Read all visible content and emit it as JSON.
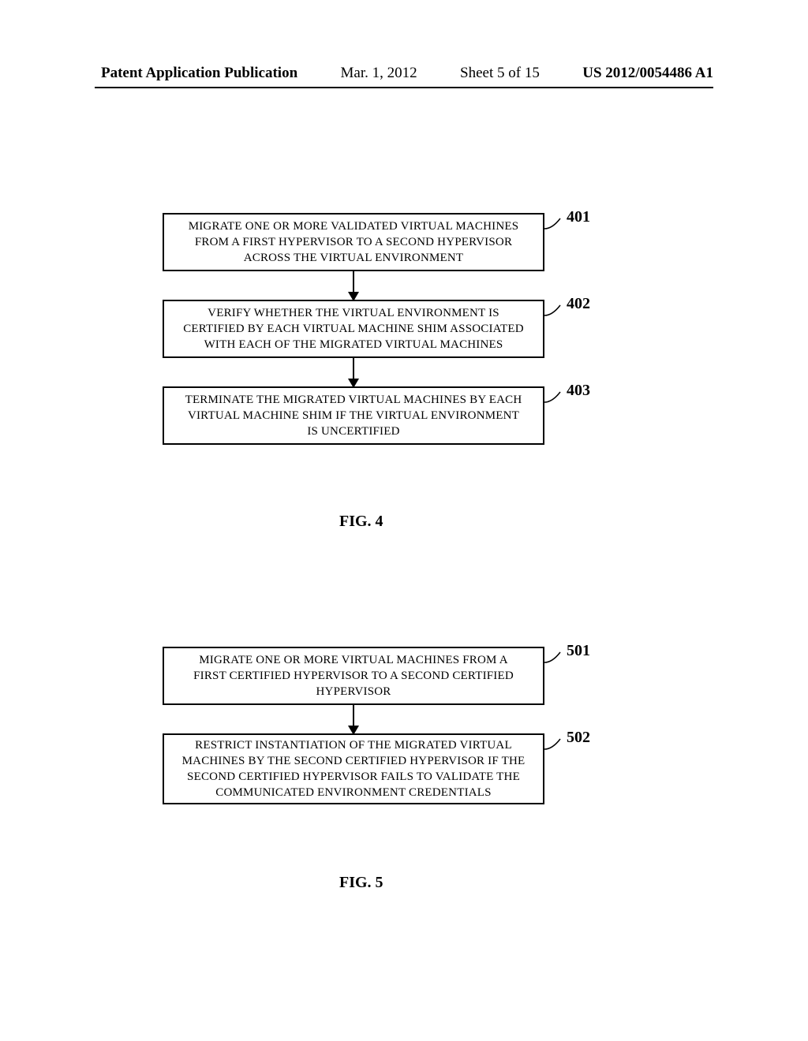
{
  "header": {
    "publication_label": "Patent Application Publication",
    "date": "Mar. 1, 2012",
    "sheet": "Sheet 5 of 15",
    "app_number": "US 2012/0054486 A1"
  },
  "fig4": {
    "caption": "FIG. 4",
    "step401": {
      "num": "401",
      "text": "MIGRATE ONE OR MORE VALIDATED VIRTUAL MACHINES FROM A FIRST HYPERVISOR TO A SECOND HYPERVISOR ACROSS THE VIRTUAL ENVIRONMENT"
    },
    "step402": {
      "num": "402",
      "text": "VERIFY WHETHER THE VIRTUAL ENVIRONMENT IS CERTIFIED BY EACH VIRTUAL MACHINE SHIM ASSOCIATED WITH EACH OF THE MIGRATED VIRTUAL MACHINES"
    },
    "step403": {
      "num": "403",
      "text": "TERMINATE THE MIGRATED VIRTUAL MACHINES BY EACH VIRTUAL MACHINE SHIM IF THE VIRTUAL ENVIRONMENT IS UNCERTIFIED"
    }
  },
  "fig5": {
    "caption": "FIG. 5",
    "step501": {
      "num": "501",
      "text": "MIGRATE ONE OR MORE VIRTUAL MACHINES FROM A FIRST CERTIFIED HYPERVISOR TO A SECOND CERTIFIED HYPERVISOR"
    },
    "step502": {
      "num": "502",
      "text": "RESTRICT INSTANTIATION OF THE MIGRATED VIRTUAL MACHINES BY THE SECOND CERTIFIED HYPERVISOR IF THE SECOND CERTIFIED HYPERVISOR FAILS TO VALIDATE THE COMMUNICATED ENVIRONMENT CREDENTIALS"
    }
  }
}
